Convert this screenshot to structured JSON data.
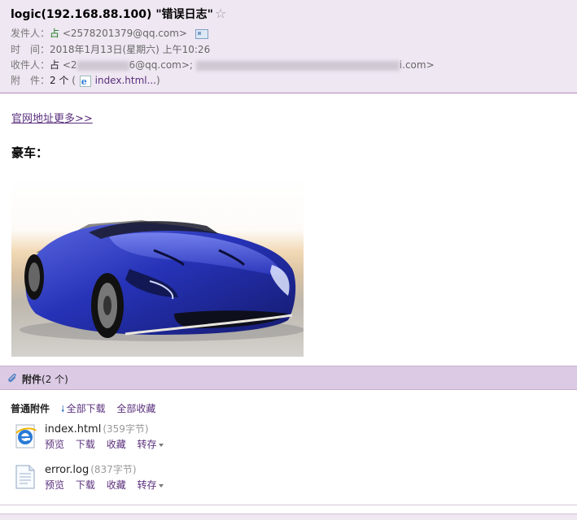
{
  "header": {
    "subject": "logic(192.168.88.100) \"错误日志\"",
    "star_glyph": "☆",
    "from_label": "发件人：",
    "from_name": "占",
    "from_address": "<2578201379@qq.com>",
    "time_label": "时　间：",
    "time_value": "2018年1月13日(星期六) 上午10:26",
    "to_label": "收件人：",
    "to_name": "占",
    "to_address_prefix": "<2",
    "to_address_mid": "6@qq.com>;",
    "to_address_tail": "i.com>",
    "attachments_label": "附　件：",
    "attachments_count": "2 个",
    "attachments_open": "(",
    "attachments_link": "index.html...",
    "attachments_close": ")"
  },
  "body": {
    "more_link": "官网地址更多>>",
    "heading": "豪车："
  },
  "attachments": {
    "bar_title": "附件",
    "bar_count": "(2 个)",
    "toolbar_label": "普通附件",
    "download_all": "全部下载",
    "save_all": "全部收藏",
    "files": [
      {
        "name": "index.html",
        "size": "(359字节)",
        "icon": "ie-file-icon",
        "actions": [
          "预览",
          "下载",
          "收藏",
          "转存"
        ]
      },
      {
        "name": "error.log",
        "size": "(837字节)",
        "icon": "text-file-icon",
        "actions": [
          "预览",
          "下载",
          "收藏",
          "转存"
        ]
      }
    ]
  },
  "colors": {
    "header_bg": "#efe7f2",
    "attach_bar_bg": "#dccae4",
    "link": "#5a2f7c",
    "sender_green": "#1c7d1c",
    "car_blue": "#2633b8"
  }
}
